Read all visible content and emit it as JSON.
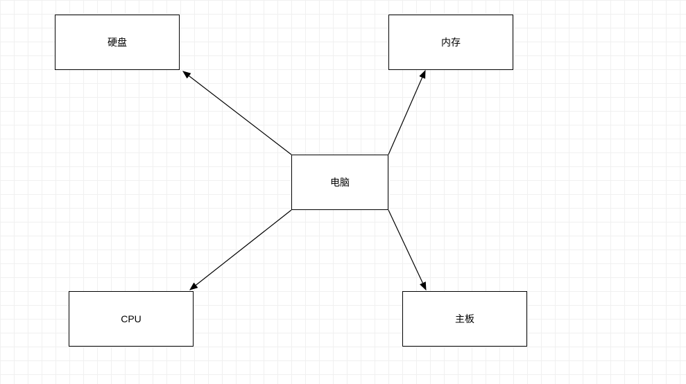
{
  "diagram": {
    "center": {
      "label": "电脑"
    },
    "nodes": {
      "topLeft": {
        "label": "硬盘"
      },
      "topRight": {
        "label": "内存"
      },
      "bottomLeft": {
        "label": "CPU"
      },
      "bottomRight": {
        "label": "主板"
      }
    }
  }
}
